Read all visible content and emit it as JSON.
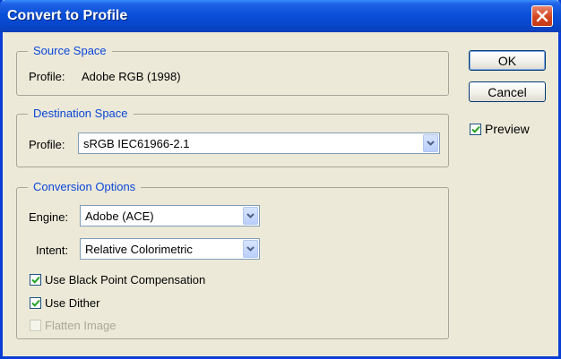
{
  "window": {
    "title": "Convert to Profile"
  },
  "source_space": {
    "legend": "Source Space",
    "profile_label": "Profile:",
    "profile_value": "Adobe RGB (1998)"
  },
  "destination_space": {
    "legend": "Destination Space",
    "profile_label": "Profile:",
    "profile_value": "sRGB IEC61966-2.1"
  },
  "conversion_options": {
    "legend": "Conversion Options",
    "engine_label": "Engine:",
    "engine_value": "Adobe (ACE)",
    "intent_label": "Intent:",
    "intent_value": "Relative Colorimetric",
    "use_bpc_label": "Use Black Point Compensation",
    "use_bpc_checked": true,
    "use_dither_label": "Use Dither",
    "use_dither_checked": true,
    "flatten_label": "Flatten Image",
    "flatten_checked": false,
    "flatten_enabled": false
  },
  "buttons": {
    "ok": "OK",
    "cancel": "Cancel"
  },
  "preview": {
    "label": "Preview",
    "checked": true
  },
  "colors": {
    "title_bar": "#0a4fd8",
    "legend_text": "#0a46d8",
    "dialog_bg": "#ece9d8",
    "close_button": "#d3461f"
  },
  "icons": {
    "close": "close-x-icon",
    "dropdown": "chevron-down-icon",
    "check": "checkmark-icon"
  }
}
